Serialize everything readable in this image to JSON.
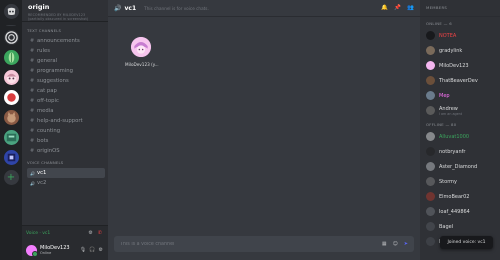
{
  "server": {
    "name": "origin",
    "subtitle": "RECOMMENDED BY MILODEV123 (partially obscured in screenshot)",
    "rail": [
      {
        "icon": "discord-home-icon",
        "color": "#36393f"
      },
      {
        "icon": "origin-swirl-icon",
        "color": "#2f3136"
      },
      {
        "icon": "leaf-server-icon",
        "color": "#3ba55d"
      },
      {
        "icon": "anime-server-icon",
        "color": "#f6c7d8"
      },
      {
        "icon": "red-server-icon",
        "color": "#d83c3e"
      },
      {
        "icon": "cat-server-icon",
        "color": "#8a5a44"
      },
      {
        "icon": "green-server-icon",
        "color": "#4aa380"
      },
      {
        "icon": "blue-server-icon",
        "color": "#2f45a8"
      }
    ]
  },
  "sidebar": {
    "text_category": "TEXT CHANNELS",
    "voice_category": "VOICE CHANNELS",
    "text_channels": [
      "announcements",
      "rules",
      "general",
      "programming",
      "suggestions",
      "cat pap",
      "off-topic",
      "media",
      "help-and-support",
      "counting",
      "bots",
      "originOS"
    ],
    "voice_channels": [
      "vc1",
      "vc2"
    ],
    "selected_voice": "vc1",
    "voice_status": "Voice · vc1"
  },
  "user": {
    "name": "MiloDev123",
    "status": "Online"
  },
  "main": {
    "channel_name": "vc1",
    "channel_desc": "This channel is for voice chats.",
    "participant_name": "MiloDev123 (y...",
    "composer_placeholder": "This is a voice channel"
  },
  "members": {
    "header": "MEMBERS",
    "online_label": "ONLINE — 6",
    "offline_label": "OFFLINE — 80",
    "online": [
      {
        "name": "NOTEA",
        "color": "#ed4245",
        "avatar": "#18191c"
      },
      {
        "name": "gradylink",
        "color": "#dcddde",
        "avatar": "#7a6a5a"
      },
      {
        "name": "MiloDev123",
        "color": "#dcddde",
        "avatar": "#f4b6ef"
      },
      {
        "name": "ThatBeaverDev",
        "color": "#dcddde",
        "avatar": "#6b4f3a"
      },
      {
        "name": "Mep",
        "color": "#ff73fa",
        "avatar": "#6a7b8c"
      },
      {
        "name": "Andrew",
        "color": "#dcddde",
        "avatar": "#5a5a5a",
        "status": "I am an agent"
      }
    ],
    "offline": [
      {
        "name": "Alluvat1000",
        "color": "#3ba55d",
        "avatar": "#f2f3f5"
      },
      {
        "name": "notbryanfr",
        "color": "#dcddde",
        "avatar": "#1e1e1e"
      },
      {
        "name": "Aster_Diamond",
        "color": "#dcddde",
        "avatar": "#cfd2d6"
      },
      {
        "name": "Stormy",
        "color": "#dcddde",
        "avatar": "#8a8a8a"
      },
      {
        "name": "ElmoBear02",
        "color": "#dcddde",
        "avatar": "#c0392b"
      },
      {
        "name": "loaf_449864",
        "color": "#dcddde",
        "avatar": "#7a7f86"
      },
      {
        "name": "Bagel",
        "color": "#dcddde",
        "avatar": "#5c5f66"
      },
      {
        "name": "bugr",
        "color": "#dcddde",
        "avatar": "#4f545c"
      }
    ]
  },
  "toast": "Joined voice: vc1",
  "colors": {
    "accent": "#5865f2",
    "online": "#3ba55d"
  }
}
